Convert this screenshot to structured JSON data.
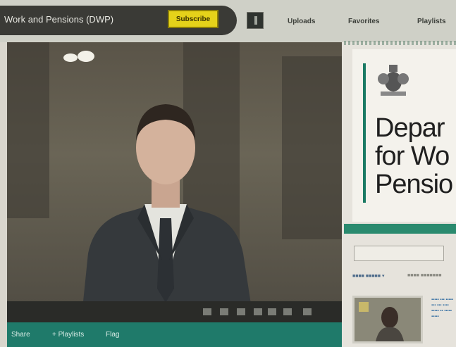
{
  "header": {
    "channel_title": "Work and Pensions (DWP)",
    "subscribe_label": "Subscribe",
    "tabs": [
      "Uploads",
      "Favorites",
      "Playlists"
    ]
  },
  "video": {
    "share_label": "Share",
    "playlists_label": "+ Playlists",
    "flag_label": "Flag"
  },
  "brand": {
    "department_name": "Depar\nfor Wo\nPensio"
  },
  "colors": {
    "accent_green": "#1f7a6a",
    "subscribe_yellow": "#e5d21a",
    "title_bar_dark": "#3a3a36"
  }
}
